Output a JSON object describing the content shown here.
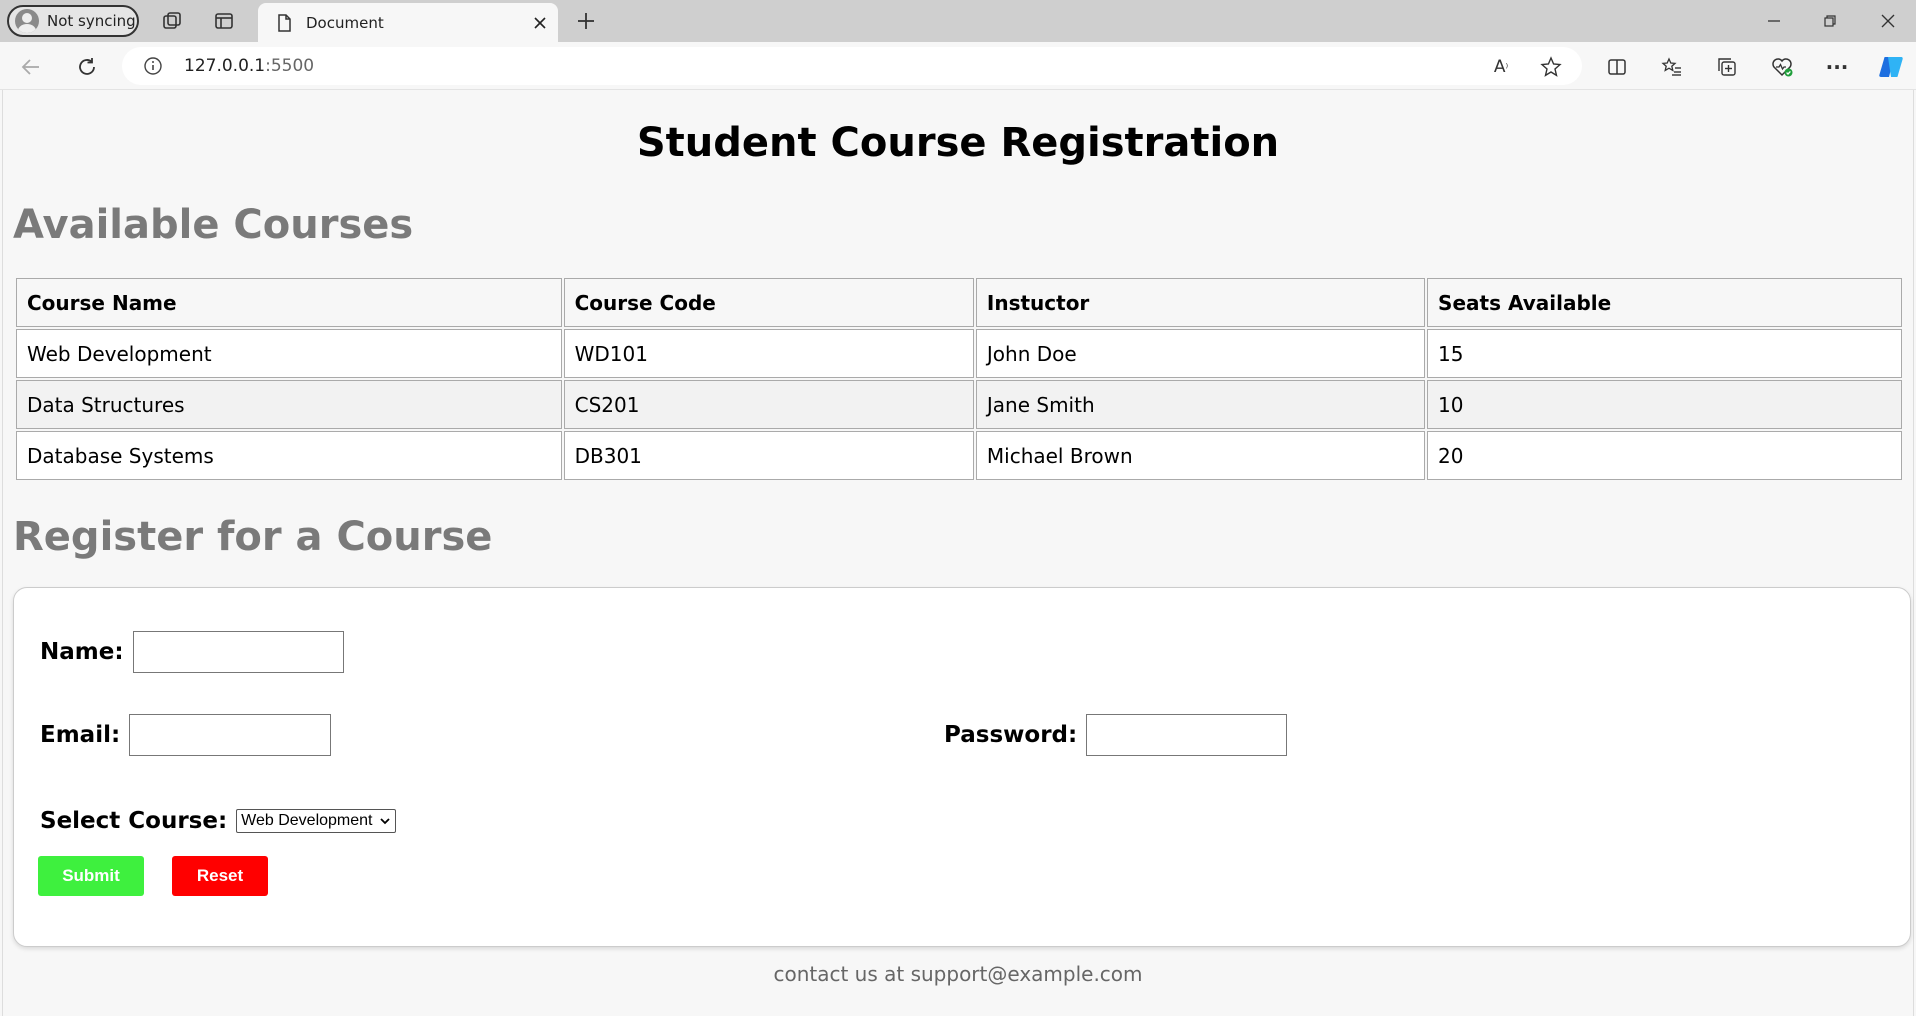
{
  "browser": {
    "profile_label": "Not syncing",
    "tab_title": "Document",
    "url_host": "127.0.0.1",
    "url_port": ":5500"
  },
  "page": {
    "title": "Student Course Registration",
    "courses_heading": "Available Courses",
    "register_heading": "Register for a Course",
    "footer": "contact us at support@example.com"
  },
  "table": {
    "headers": [
      "Course Name",
      "Course Code",
      "Instuctor",
      "Seats Available"
    ],
    "rows": [
      [
        "Web Development",
        "WD101",
        "John Doe",
        "15"
      ],
      [
        "Data Structures",
        "CS201",
        "Jane Smith",
        "10"
      ],
      [
        "Database Systems",
        "DB301",
        "Michael Brown",
        "20"
      ]
    ]
  },
  "form": {
    "name_label": "Name:",
    "name_value": "",
    "email_label": "Email:",
    "email_value": "",
    "password_label": "Password:",
    "password_value": "",
    "course_label": "Select Course:",
    "course_selected": "Web Development",
    "submit_label": "Submit",
    "reset_label": "Reset"
  },
  "colors": {
    "submit": "#3ef03e",
    "reset": "#ff0000",
    "heading_gray": "#7a7a7a"
  }
}
